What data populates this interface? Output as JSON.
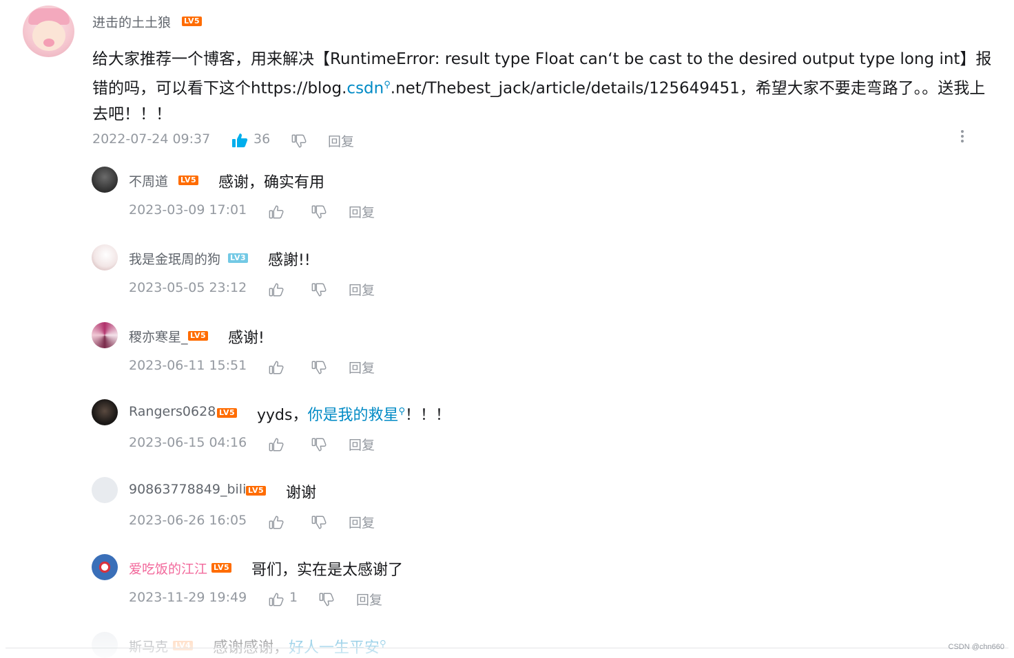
{
  "main_comment": {
    "username": "进击的土土狼",
    "level": "LV5",
    "text_before": "给大家推荐一个博客，用来解决【RuntimeError: result type Float can‘t be cast to the desired output type long int】报错的吗，可以看下这个https://blog.",
    "link_text": "csdn",
    "text_after": ".net/Thebest_jack/article/details/125649451，希望大家不要走弯路了。。送我上去吧！！！",
    "time": "2022-07-24 09:37",
    "likes": "36",
    "reply_label": "回复"
  },
  "replies": [
    {
      "username": "不周道",
      "level": "LV5",
      "text": "感谢，确实有用",
      "link": "",
      "suffix": "",
      "time": "2023-03-09 17:01",
      "likes": "",
      "reply_label": "回复"
    },
    {
      "username": "我是金珉周的狗",
      "level": "LV3",
      "text": "感謝!!",
      "link": "",
      "suffix": "",
      "time": "2023-05-05 23:12",
      "likes": "",
      "reply_label": "回复"
    },
    {
      "username": "稷亦寒星_",
      "level": "LV5",
      "text": "感谢!",
      "link": "",
      "suffix": "",
      "time": "2023-06-11 15:51",
      "likes": "",
      "reply_label": "回复"
    },
    {
      "username": "Rangers0628",
      "level": "LV5",
      "text": "yyds，",
      "link": "你是我的救星",
      "suffix": "！！！",
      "time": "2023-06-15 04:16",
      "likes": "",
      "reply_label": "回复"
    },
    {
      "username": "90863778849_bili",
      "level": "LV5",
      "text": "谢谢",
      "link": "",
      "suffix": "",
      "time": "2023-06-26 16:05",
      "likes": "",
      "reply_label": "回复"
    },
    {
      "username": "爱吃饭的江江",
      "level": "LV5",
      "text": "哥们，实在是太感谢了",
      "link": "",
      "suffix": "",
      "time": "2023-11-29 19:49",
      "likes": "1",
      "reply_label": "回复"
    },
    {
      "username": "斯马克",
      "level": "LV4",
      "text": "感谢感谢，",
      "link": "好人一生平安",
      "suffix": "",
      "time": "",
      "likes": "",
      "reply_label": ""
    }
  ],
  "watermark": "CSDN @chn660",
  "colors": {
    "link": "#008ac5",
    "like_active": "#00aeec",
    "lv5": "#ff6c00",
    "lv3": "#73c9e5",
    "vip_name": "#f2689b"
  },
  "icons": [
    "thumbs-up-icon",
    "thumbs-down-icon",
    "search-icon",
    "more-icon"
  ]
}
